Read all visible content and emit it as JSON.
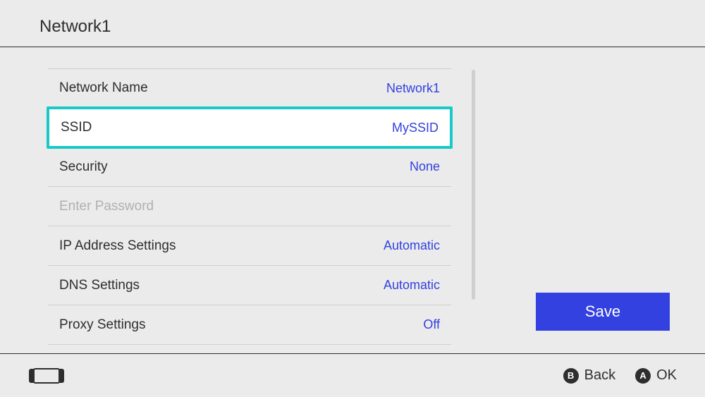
{
  "header": {
    "title": "Network1"
  },
  "settings": {
    "items": [
      {
        "label": "Network Name",
        "value": "Network1",
        "disabled": false,
        "selected": false
      },
      {
        "label": "SSID",
        "value": "MySSID",
        "disabled": false,
        "selected": true
      },
      {
        "label": "Security",
        "value": "None",
        "disabled": false,
        "selected": false
      },
      {
        "label": "Enter Password",
        "value": "",
        "disabled": true,
        "selected": false
      },
      {
        "label": "IP Address Settings",
        "value": "Automatic",
        "disabled": false,
        "selected": false
      },
      {
        "label": "DNS Settings",
        "value": "Automatic",
        "disabled": false,
        "selected": false
      },
      {
        "label": "Proxy Settings",
        "value": "Off",
        "disabled": false,
        "selected": false
      }
    ]
  },
  "actions": {
    "save": "Save"
  },
  "footer": {
    "back_button": "B",
    "back_label": "Back",
    "ok_button": "A",
    "ok_label": "OK"
  }
}
